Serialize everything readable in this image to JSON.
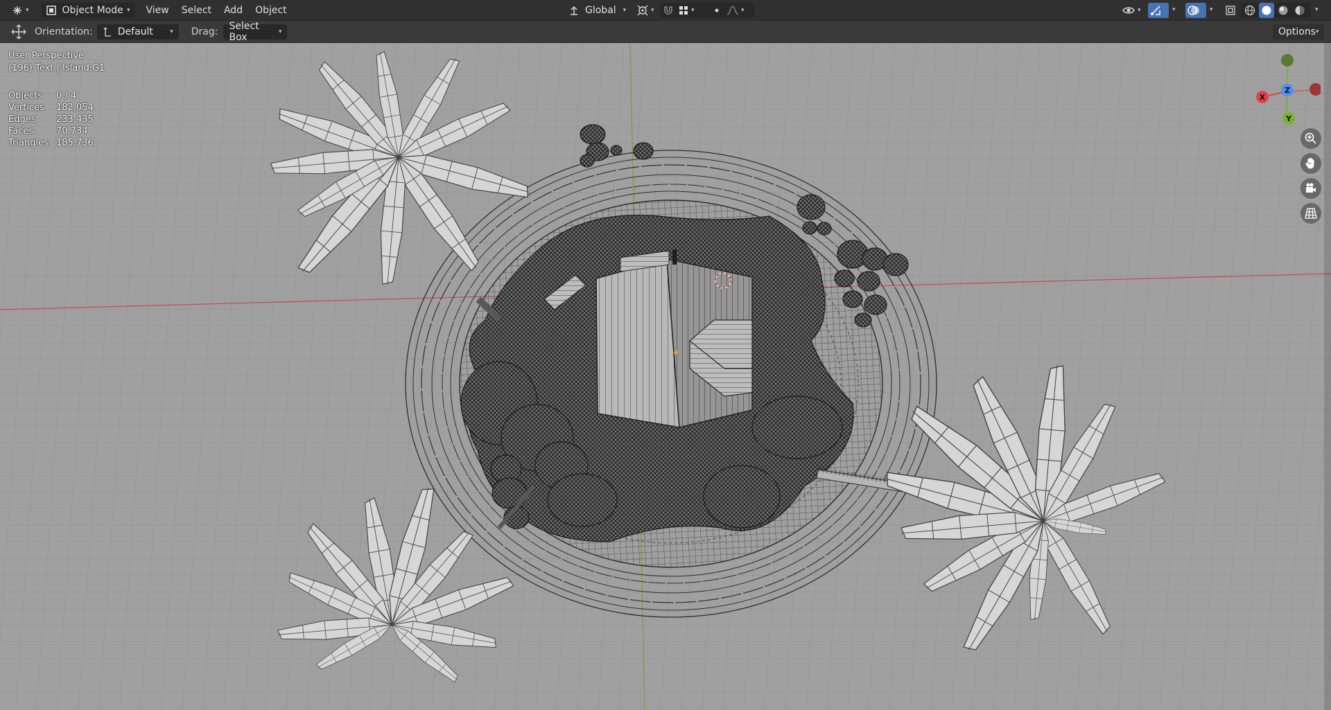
{
  "header": {
    "editor_type_icon": "3d-viewport-icon",
    "mode": "Object Mode",
    "menus": [
      "View",
      "Select",
      "Add",
      "Object"
    ],
    "transform_orientation": "Global",
    "shading_modes": [
      "wireframe",
      "solid",
      "material-preview",
      "rendered"
    ],
    "active_shading": "solid"
  },
  "toolbar": {
    "orientation_label": "Orientation:",
    "orientation_value": "Default",
    "drag_label": "Drag:",
    "drag_value": "Select Box",
    "options_label": "Options"
  },
  "viewport": {
    "perspective": "User Perspective",
    "active_object": "(196) Text | Island.G1",
    "stats": [
      {
        "label": "Objects",
        "value": "0 / 4"
      },
      {
        "label": "Vertices",
        "value": "182,054"
      },
      {
        "label": "Edges",
        "value": "233,435"
      },
      {
        "label": "Faces",
        "value": "70,734"
      },
      {
        "label": "Triangles",
        "value": "185,736"
      }
    ],
    "gizmo": {
      "x_label": "X",
      "y_label": "Y",
      "z_label": "Z",
      "x_color": "#e2434b",
      "y_color": "#7ab32b",
      "z_color": "#4d8ff2"
    },
    "nav_buttons": [
      "zoom-icon",
      "hand-pan-icon",
      "camera-icon",
      "grid-ortho-icon"
    ],
    "colors": {
      "background": "#a0a0a0",
      "x_axis": "#c45050",
      "y_axis": "#75a03a"
    }
  }
}
